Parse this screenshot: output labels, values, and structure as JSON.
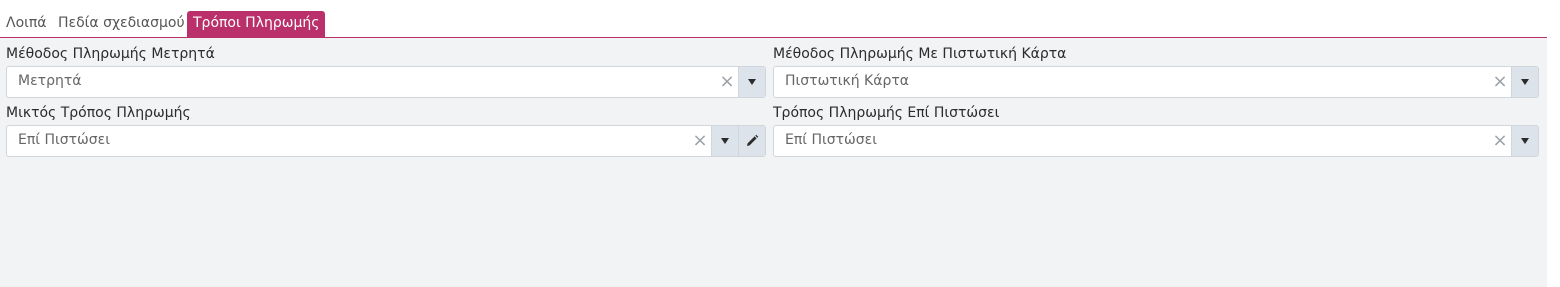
{
  "tabs": [
    {
      "label": "Λοιπά",
      "active": false
    },
    {
      "label": "Πεδία σχεδιασμού",
      "active": false
    },
    {
      "label": "Τρόποι Πληρωμής",
      "active": true
    }
  ],
  "fields": {
    "cash": {
      "label": "Μέθοδος Πληρωμής Μετρητά",
      "value": "Μετρητά",
      "clear": "×"
    },
    "card": {
      "label": "Μέθοδος Πληρωμής Με Πιστωτική Κάρτα",
      "value": "Πιστωτική Κάρτα",
      "clear": "×"
    },
    "mixed": {
      "label": "Μικτός Τρόπος Πληρωμής",
      "value": "Επί Πιστώσει",
      "clear": "×"
    },
    "credit": {
      "label": "Τρόπος Πληρωμής Επί Πιστώσει",
      "value": "Επί Πιστώσει",
      "clear": "×"
    }
  },
  "colors": {
    "accent": "#b9306a",
    "background": "#f1f3f4"
  },
  "icons": {
    "clear": "close-icon",
    "dropdown": "chevron-down-icon",
    "edit": "pencil-icon"
  }
}
